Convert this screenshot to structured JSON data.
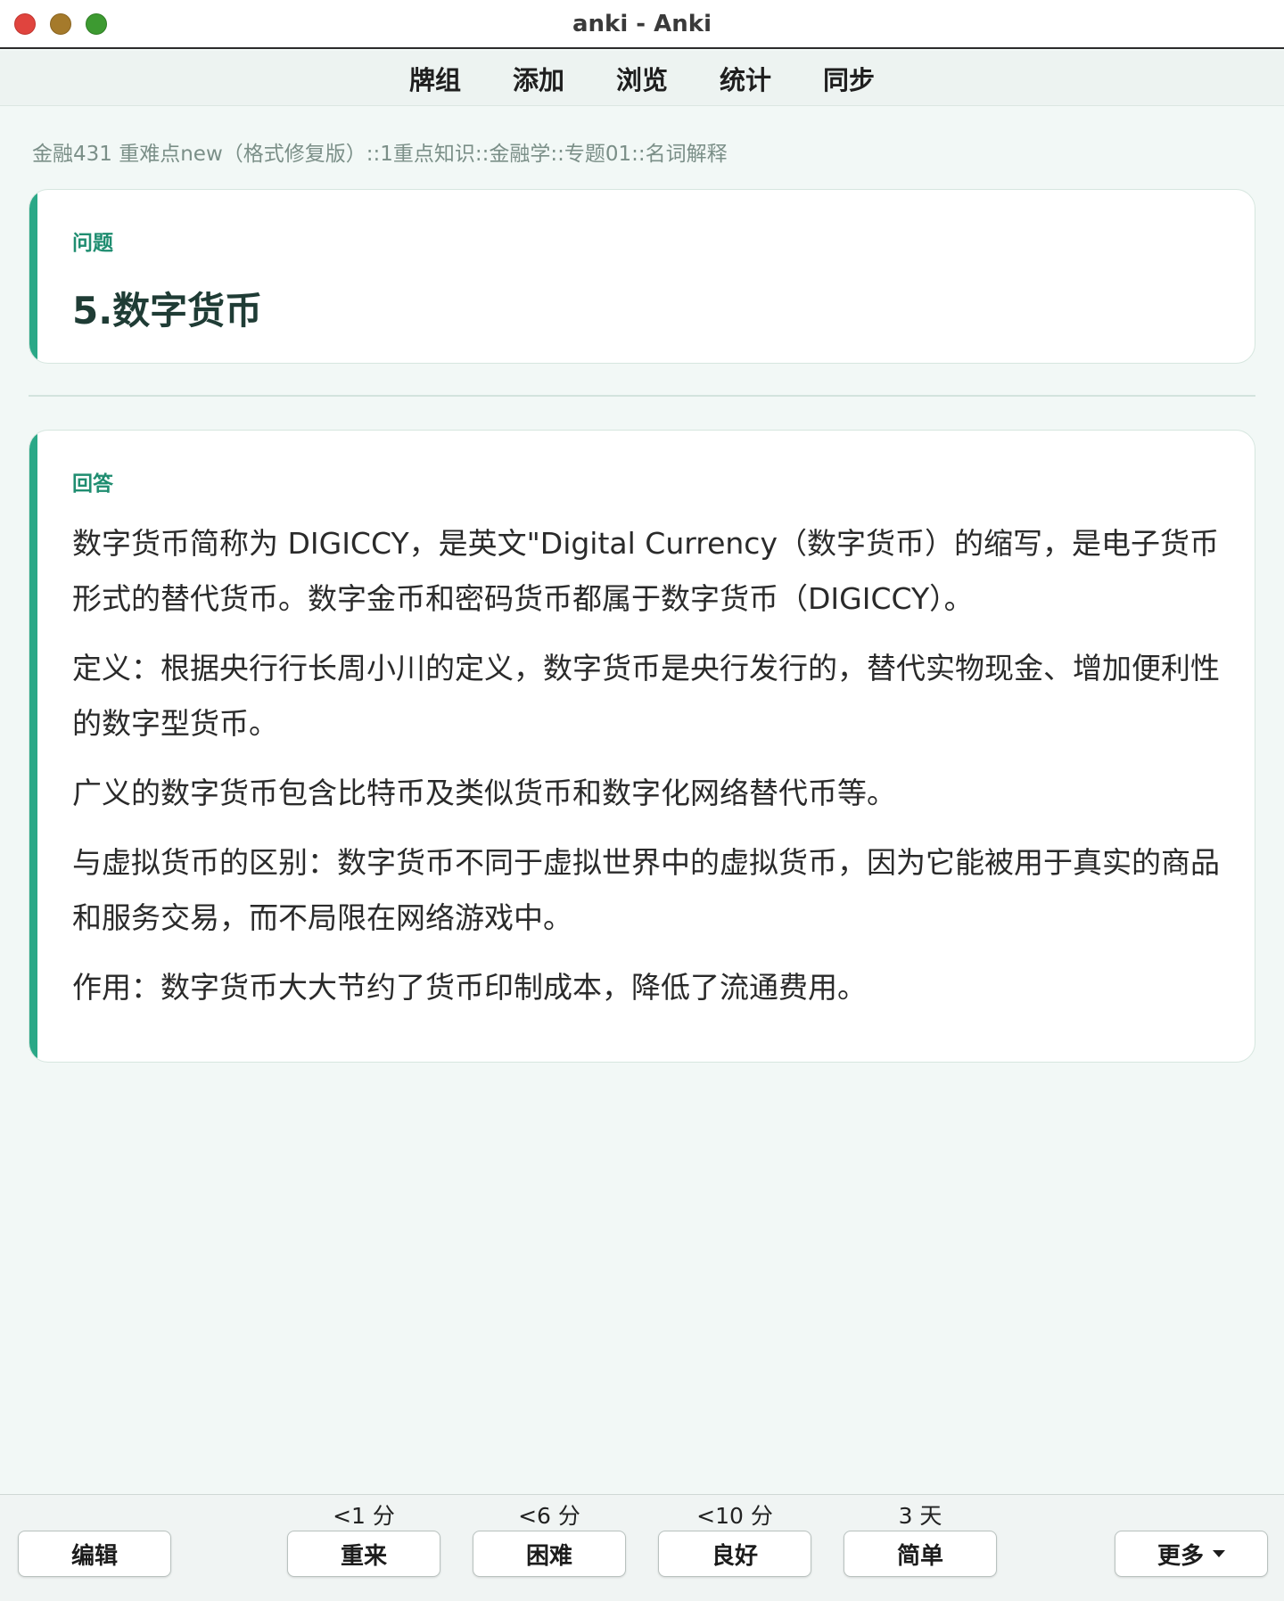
{
  "window": {
    "title": "anki - Anki"
  },
  "toolbar": {
    "items": [
      "牌组",
      "添加",
      "浏览",
      "统计",
      "同步"
    ]
  },
  "breadcrumb": "金融431 重难点new（格式修复版）::1重点知识::金融学::专题01::名词解释",
  "question": {
    "label": "问题",
    "text": "5.数字货币"
  },
  "answer": {
    "label": "回答",
    "paragraphs": [
      "数字货币简称为 DIGICCY，是英文\"Digital Currency（数字货币）的缩写，是电子货币形式的替代货币。数字金币和密码货币都属于数字货币（DIGICCY）。",
      "定义：根据央行行长周小川的定义，数字货币是央行发行的，替代实物现金、增加便利性的数字型货币。",
      "广义的数字货币包含比特币及类似货币和数字化网络替代币等。",
      "与虚拟货币的区别：数字货币不同于虚拟世界中的虚拟货币，因为它能被用于真实的商品和服务交易，而不局限在网络游戏中。",
      "作用：数字货币大大节约了货币印制成本，降低了流通费用。"
    ]
  },
  "bottom": {
    "edit_label": "编辑",
    "more_label": "更多",
    "more_icon": "caret-down-icon",
    "answers": [
      {
        "interval": "<1 分",
        "label": "重来"
      },
      {
        "interval": "<6 分",
        "label": "困难"
      },
      {
        "interval": "<10 分",
        "label": "良好"
      },
      {
        "interval": "3 天",
        "label": "简单"
      }
    ]
  },
  "colors": {
    "accent": "#2aa887",
    "label": "#1f8d70",
    "background": "#f2f8f6"
  }
}
